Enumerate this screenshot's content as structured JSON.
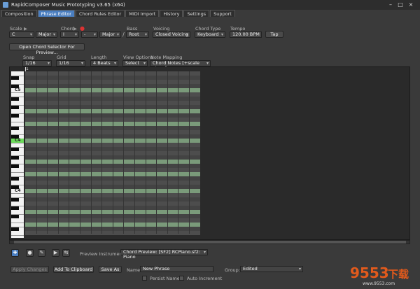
{
  "window": {
    "title": "RapidComposer Music Prototyping v3.65 (x64)"
  },
  "tabs": [
    "Composition",
    "Phrase Editor",
    "Chord Rules Editor",
    "MIDI Import",
    "History",
    "Settings",
    "Support"
  ],
  "controls": {
    "scale_label": "Scale",
    "scale_root": "C",
    "scale_type": "Major",
    "chord_label": "Chord",
    "chord_value": "I",
    "chord_sep": "-",
    "chord_quality": "Major",
    "slash": "/",
    "bass_label": "Bass",
    "bass_value": "Root",
    "voicing_label": "Voicing",
    "voicing_value": "Closed Voicing",
    "chordtype_label": "Chord Type",
    "chordtype_value": "Keyboard",
    "tempo_label": "Tempo",
    "tempo_value": "120.00 BPM",
    "tap": "Tap",
    "open_selector": "Open Chord Selector For Preview...",
    "snap_label": "Snap",
    "snap_value": "1/16",
    "grid_label": "Grid",
    "grid_value": "1/16",
    "length_label": "Length",
    "length_value": "4 Beats",
    "viewopt_label": "View Options",
    "viewopt_value": "Select",
    "mapping_label": "Note Mapping",
    "mapping_value": "Chord Notes [+scale steps]"
  },
  "roll": {
    "ruler_mark": "1",
    "c5": "C5",
    "c4": "C4"
  },
  "bottom": {
    "preview_label": "Preview Instrument:",
    "preview_value": "Chord Preview: [SF2] RCPiano.sf2: Piano",
    "apply": "Apply Changes",
    "add_clip": "Add To Clipboard",
    "save_as": "Save As",
    "name_label": "Name:",
    "name_value": "New Phrase",
    "group_label": "Group:",
    "group_value": "Edited",
    "persist": "Persist Name",
    "auto": "Auto Increment"
  },
  "watermark": {
    "brand": "9553",
    "suffix": "下载",
    "url": "www.9553.com"
  },
  "colors": {
    "accent": "#4a7ec0",
    "scale_row": "#7a9a7a",
    "key_highlight": "#6bdc5a"
  }
}
